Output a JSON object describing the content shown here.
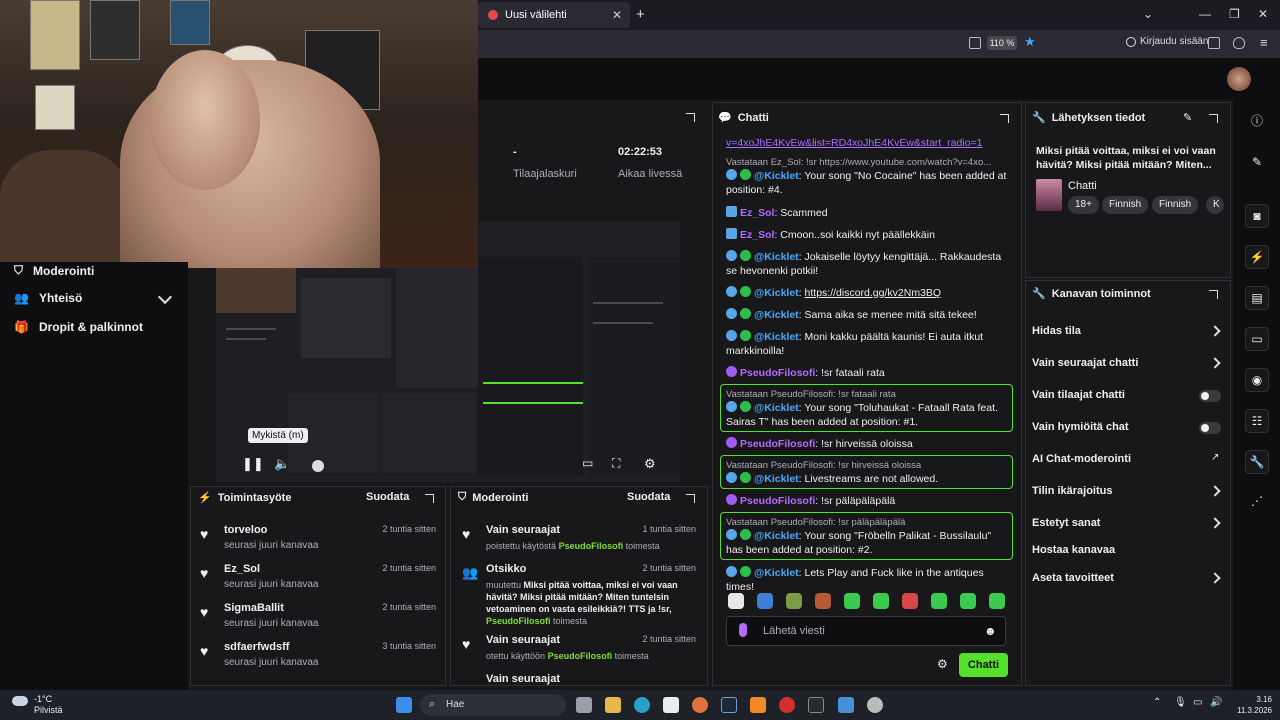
{
  "browser": {
    "tab_title": "Uusi välilehti",
    "zoom": "110 %",
    "login_label": "Kirjaudu sisään"
  },
  "stats": {
    "subs_value": "-",
    "subs_label": "Tilaajalaskuri",
    "live_value": "02:22:53",
    "live_label": "Aikaa livessä"
  },
  "sidebar": {
    "items": [
      {
        "label": "Moderointi"
      },
      {
        "label": "Yhteisö"
      },
      {
        "label": "Dropit & palkinnot"
      }
    ]
  },
  "video": {
    "tooltip": "Mykistä (m)"
  },
  "activity": {
    "title": "Toimintasyöte",
    "filter": "Suodata",
    "items": [
      {
        "name": "torveloo",
        "sub": "seurasi juuri kanavaa",
        "time": "2 tuntia sitten"
      },
      {
        "name": "Ez_Sol",
        "sub": "seurasi juuri kanavaa",
        "time": "2 tuntia sitten"
      },
      {
        "name": "SigmaBallit",
        "sub": "seurasi juuri kanavaa",
        "time": "2 tuntia sitten"
      },
      {
        "name": "sdfaerfwdsff",
        "sub": "seurasi juuri kanavaa",
        "time": "3 tuntia sitten"
      }
    ]
  },
  "moderation": {
    "title": "Moderointi",
    "filter": "Suodata",
    "items": [
      {
        "name": "Vain seuraajat",
        "time": "1 tuntia sitten",
        "pre": "poistettu käytöstä",
        "user": "PseudoFilosofi",
        "post": "toimesta"
      },
      {
        "name": "Otsikko",
        "time": "2 tuntia sitten",
        "pre": "muutettu",
        "quote": "Miksi pitää voittaa, miksi ei voi vaan hävitä? Miksi pitää mitään? Miten tuntelsin vetoaminen on vasta esileikkiä?! TTS ja !sr,",
        "user": "PseudoFilosofi",
        "post": "toimesta"
      },
      {
        "name": "Vain seuraajat",
        "time": "2 tuntia sitten",
        "pre": "otettu käyttöön",
        "user": "PseudoFilosofi",
        "post": "toimesta"
      },
      {
        "name": "Vain seuraajat",
        "time": "",
        "pre": "",
        "user": "",
        "post": ""
      }
    ]
  },
  "chat": {
    "title": "Chatti",
    "input_placeholder": "Lähetä viesti",
    "send_label": "Chatti",
    "messages": {
      "m0": "v=4xoJhE4KvEw&list=RD4xoJhE4KvEw&start_radio=1",
      "m1_reply": "Vastataan Ez_Sol: !sr https://www.youtube.com/watch?v=4xo...",
      "m1_user": "@Kicklet",
      "m1_text": ": Your song \"No Cocaine\" has been added at position: #4.",
      "m2_user": "Ez_Sol",
      "m2_text": ": Scammed",
      "m3_user": "Ez_Sol",
      "m3_text": ": Cmoon..soi kaikki nyt päällekkäin",
      "m4_user": "@Kicklet",
      "m4_text": ": Jokaiselle löytyy kengittäjä... Rakkaudesta se hevonenki potkii!",
      "m5_user": "@Kicklet",
      "m5_text": "https://discord.gg/kv2Nm3BQ",
      "m6_user": "@Kicklet",
      "m6_text": ": Sama aika se menee mitä sitä tekee!",
      "m7_user": "@Kicklet",
      "m7_text": ": Moni kakku päältä kaunis! Ei auta itkut markkinoilla!",
      "m8_user": "PseudoFilosofi",
      "m8_text": ": !sr fataali rata",
      "m9_reply": "Vastataan PseudoFilosofi: !sr fataali rata",
      "m9_user": "@Kicklet",
      "m9_text": ": Your song \"Toluhaukat - Fataall Rata feat. Sairas T\" has been added at position: #1.",
      "m10_user": "PseudoFilosofi",
      "m10_text": ": !sr hirveissä oloissa",
      "m11_reply": "Vastataan PseudoFilosofi: !sr hirveissä oloissa",
      "m11_user": "@Kicklet",
      "m11_text": ": Livestreams are not allowed.",
      "m12_user": "PseudoFilosofi",
      "m12_text": ": !sr päläpäläpälä",
      "m13_reply": "Vastataan PseudoFilosofi: !sr päläpäläpälä",
      "m13_user": "@Kicklet",
      "m13_text": ": Your song \"Fröbelln Palikat - Bussilaulu\" has been added at position: #2.",
      "m14_user": "@Kicklet",
      "m14_text": ": Lets Play and Fuck like in the antiques times!"
    }
  },
  "stream_info": {
    "title": "Lähetyksen tiedot",
    "stream_title": "Miksi pitää voittaa, miksi ei voi vaan hävitä? Miksi pitää mitään? Miten...",
    "category": "Chatti",
    "tags": [
      "18+",
      "Finnish",
      "Finnish",
      "K"
    ]
  },
  "channel_actions": {
    "title": "Kanavan toiminnot",
    "items": [
      {
        "label": "Hidas tila"
      },
      {
        "label": "Vain seuraajat chatti"
      },
      {
        "label": "Vain tilaajat chatti"
      },
      {
        "label": "Vain hymiöitä chat"
      },
      {
        "label": "AI Chat-moderointi"
      },
      {
        "label": "Tilin ikärajoitus"
      },
      {
        "label": "Estetyt sanat"
      },
      {
        "label": "Hostaa kanavaa"
      },
      {
        "label": "Aseta tavoitteet"
      }
    ]
  },
  "taskbar": {
    "weather_temp": "-1°C",
    "weather_desc": "Pilvistä",
    "search_label": "Hae",
    "time": "3.16",
    "date": "11.3.2026"
  },
  "colors": {
    "accent_green": "#55e02c",
    "bot_blue": "#47a9ff",
    "user_purple": "#b36bff"
  }
}
